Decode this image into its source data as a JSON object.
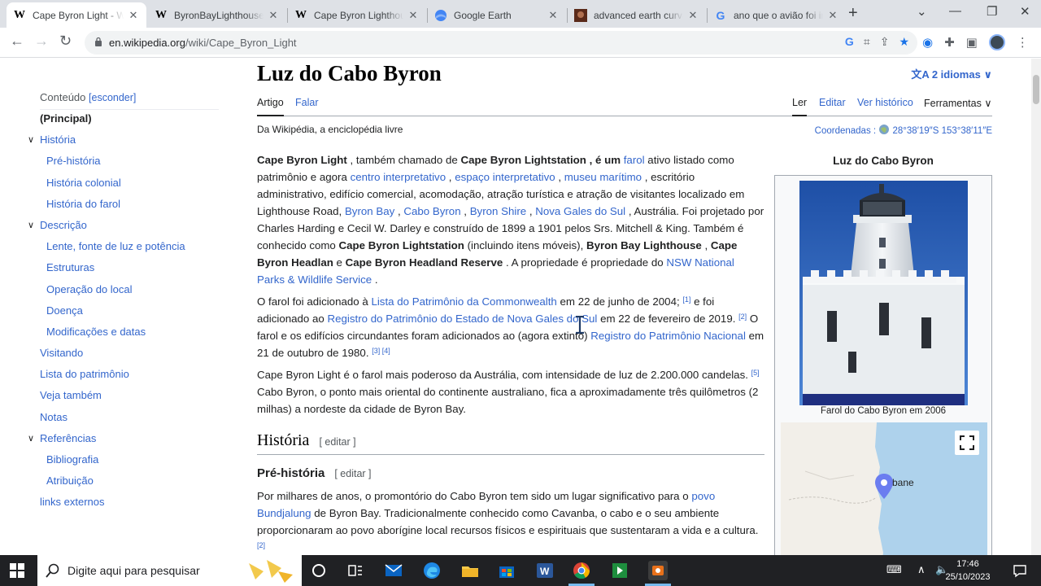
{
  "browser": {
    "tabs": [
      {
        "title": "Cape Byron Light - Wikipedia",
        "favicon": "W",
        "active": true
      },
      {
        "title": "ByronBayLighthouse",
        "favicon": "W",
        "active": false
      },
      {
        "title": "Cape Byron Lighthouse",
        "favicon": "W",
        "active": false
      },
      {
        "title": "Google Earth",
        "favicon": "earth",
        "active": false
      },
      {
        "title": "advanced earth curvature",
        "favicon": "img",
        "active": false
      },
      {
        "title": "ano que o avião foi inventado",
        "favicon": "G",
        "active": false
      }
    ],
    "new_tab": "+",
    "url_domain": "en.wikipedia.org",
    "url_path": "/wiki/Cape_Byron_Light"
  },
  "wiki": {
    "title": "Luz do Cabo Byron",
    "languages": "2 idiomas",
    "tabs_left": [
      "Artigo",
      "Falar"
    ],
    "tabs_right": [
      "Ler",
      "Editar",
      "Ver histórico",
      "Ferramentas"
    ],
    "from_wiki": "Da Wikipédia, a enciclopédia livre",
    "coords_label": "Coordenadas :",
    "coords_value": "28°38′19″S 153°38′11″E",
    "toc_header": "Conteúdo",
    "toc_hide": "[esconder]",
    "toc": [
      {
        "label": "(Principal)",
        "level": 1,
        "current": true
      },
      {
        "label": "História",
        "level": 1,
        "expand": true
      },
      {
        "label": "Pré-história",
        "level": 2
      },
      {
        "label": "História colonial",
        "level": 2
      },
      {
        "label": "História do farol",
        "level": 2
      },
      {
        "label": "Descrição",
        "level": 1,
        "expand": true
      },
      {
        "label": "Lente, fonte de luz e potência",
        "level": 2
      },
      {
        "label": "Estruturas",
        "level": 2
      },
      {
        "label": "Operação do local",
        "level": 2
      },
      {
        "label": "Doença",
        "level": 2
      },
      {
        "label": "Modificações e datas",
        "level": 2
      },
      {
        "label": "Visitando",
        "level": 1
      },
      {
        "label": "Lista do patrimônio",
        "level": 1
      },
      {
        "label": "Veja também",
        "level": 1
      },
      {
        "label": "Notas",
        "level": 1
      },
      {
        "label": "Referências",
        "level": 1,
        "expand": true
      },
      {
        "label": "Bibliografia",
        "level": 2
      },
      {
        "label": "Atribuição",
        "level": 2
      },
      {
        "label": "links externos",
        "level": 1
      }
    ],
    "p1": {
      "b1": "Cape Byron Light",
      "t1": " , também chamado de ",
      "b2": "Cape Byron Lightstation , é um",
      "t2": " ",
      "l1": "farol",
      "t3": " ativo listado como patrimônio e agora ",
      "l2": "centro interpretativo",
      "t4": " , ",
      "l3": "espaço interpretativo",
      "t5": " , ",
      "l4": "museu marítimo",
      "t6": " , escritório administrativo, edifício comercial, acomodação, atração turística e atração de visitantes localizado em Lighthouse Road, ",
      "l5": "Byron Bay",
      "t7": " , ",
      "l6": "Cabo Byron",
      "t8": " , ",
      "l7": "Byron Shire",
      "t9": " , ",
      "l8": "Nova Gales do Sul",
      "t10": " , Austrália. Foi projetado por Charles Harding e Cecil W. Darley e construído de 1899 a 1901 pelos Srs. Mitchell & King. Também é conhecido como ",
      "b3": "Cape Byron Lightstation",
      "t11": " (incluindo itens móveis), ",
      "b4": "Byron Bay Lighthouse",
      "t12": " , ",
      "b5": "Cape Byron Headlan",
      "t13": " e ",
      "b6": "Cape Byron Headland Reserve",
      "t14": " . A propriedade é propriedade do ",
      "l9": "NSW National Parks & Wildlife Service",
      "t15": " ."
    },
    "p2": {
      "t1": "O farol foi adicionado à ",
      "l1": "Lista do Patrimônio da Commonwealth",
      "t2": " em 22 de junho de 2004; ",
      "s1": "[1]",
      "t3": " e foi adicionado ao ",
      "l2": "Registro do Patrimônio do Estado de Nova Gales do Sul",
      "t4": " em 22 de fevereiro de 2019. ",
      "s2": "[2]",
      "t5": " O farol e os edifícios circundantes foram adicionados ao (agora extinto) ",
      "l3": "Registro do Patrimônio Nacional",
      "t6": " em 21 de outubro de 1980. ",
      "s3": "[3] [4]"
    },
    "p3": {
      "t1": "Cape Byron Light é o farol mais poderoso da Austrália, com intensidade de luz de 2.200.000 candelas. ",
      "s1": "[5]",
      "t2": " Cabo Byron, o ponto mais oriental do continente australiano, fica a aproximadamente três quilômetros (2 milhas) a nordeste da cidade de Byron Bay."
    },
    "h2_historia": "História",
    "edit_label": "[ editar ]",
    "h3_prehistoria": "Pré-história",
    "p4": {
      "t1": "Por milhares de anos, o promontório do Cabo Byron tem sido um lugar significativo para o ",
      "l1": "povo Bundjalung",
      "t2": " de Byron Bay. Tradicionalmente conhecido como Cavanba, o cabo e o seu ambiente proporcionaram ao povo aborígine local recursos físicos e espirituais que sustentaram a vida e a cultura. ",
      "s1": "[2]"
    },
    "infobox_title": "Luz do Cabo Byron",
    "infobox_caption": "Farol do Cabo Byron em 2006",
    "map_label": "bane"
  },
  "taskbar": {
    "search_placeholder": "Digite aqui para pesquisar",
    "time": "17:46",
    "date": "25/10/2023"
  }
}
